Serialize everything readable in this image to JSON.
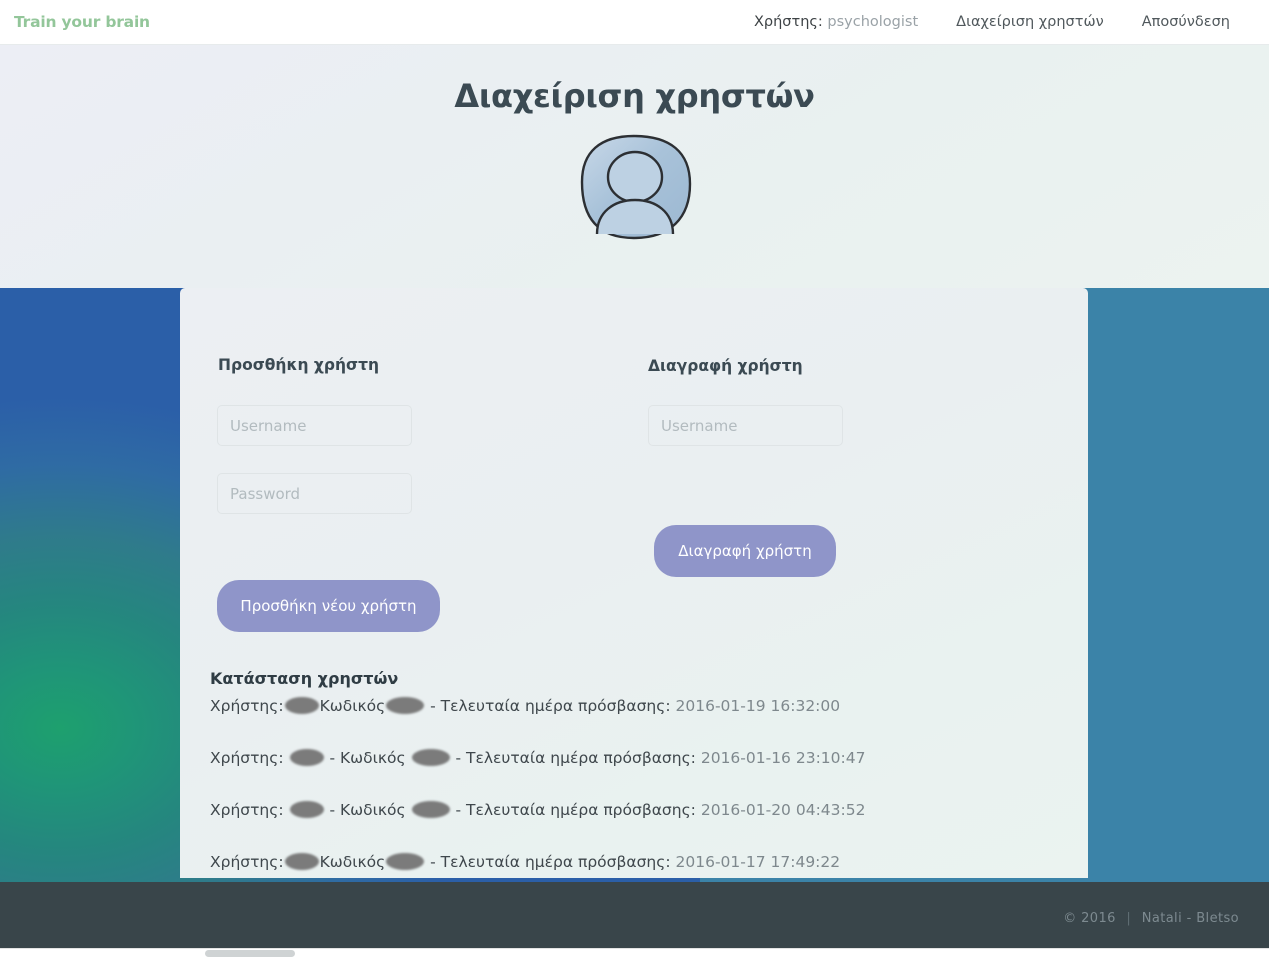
{
  "navbar": {
    "brand": "Train your brain",
    "user_label": "Χρήστης:",
    "user_value": "psychologist",
    "manage_users": "Διαχείριση χρηστών",
    "logout": "Αποσύνδεση"
  },
  "hero": {
    "title": "Διαχείριση χρηστών",
    "avatar_icon": "user-avatar-icon"
  },
  "add_user": {
    "heading": "Προσθήκη χρήστη",
    "username_placeholder": "Username",
    "username_value": "",
    "password_placeholder": "Password",
    "password_value": "",
    "submit_label": "Προσθήκη νέου χρήστη"
  },
  "delete_user": {
    "heading": "Διαγραφή χρήστη",
    "username_placeholder": "Username",
    "username_value": "",
    "submit_label": "Διαγραφή χρήστη"
  },
  "status": {
    "heading": "Κατάσταση χρηστών",
    "label_user": "Χρήστης:",
    "label_pass": "Κωδικός",
    "label_last": "- Τελευταία ημέρα πρόσβασης:",
    "dash": "-",
    "rows": [
      {
        "username": "redacted",
        "password": "redacted",
        "last_access": "2016-01-19 16:32:00"
      },
      {
        "username": "redacted",
        "password": "redacted",
        "last_access": "2016-01-16 23:10:47"
      },
      {
        "username": "redacted",
        "password": "redacted",
        "last_access": "2016-01-20 04:43:52"
      },
      {
        "username": "redacted",
        "password": "redacted",
        "last_access": "2016-01-17 17:49:22"
      }
    ]
  },
  "footer": {
    "copyright": "© 2016",
    "separator": "|",
    "author": "Natali - Bletso"
  },
  "colors": {
    "brand_green": "#93c69a",
    "title_slate": "#3b4a53",
    "button_purple": "#8f95c9",
    "footer_dark": "#39454a",
    "bg_green": "#1ea06e",
    "bg_blue": "#3b83a8"
  }
}
